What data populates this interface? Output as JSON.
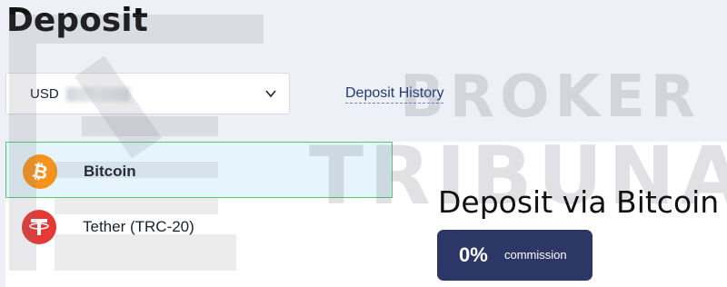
{
  "page": {
    "title": "Deposit"
  },
  "currency_select": {
    "value": "USD",
    "icon": "chevron-down-icon"
  },
  "history_link": {
    "label": "Deposit History"
  },
  "methods": [
    {
      "label": "Bitcoin",
      "icon": "bitcoin-icon",
      "selected": true,
      "color": "#f7931a"
    },
    {
      "label": "Tether (TRC-20)",
      "icon": "tether-icon",
      "selected": false,
      "color": "#e53935"
    }
  ],
  "deposit_panel": {
    "title": "Deposit via Bitcoin",
    "commission_value": "0%",
    "commission_label": "commission"
  },
  "watermark": {
    "line1": "BROKER",
    "line2": "TRIBUNAL"
  },
  "colors": {
    "background": "#edf0f6",
    "selected_border": "#56c66b",
    "badge": "#2d3766",
    "link": "#1d3a78"
  }
}
